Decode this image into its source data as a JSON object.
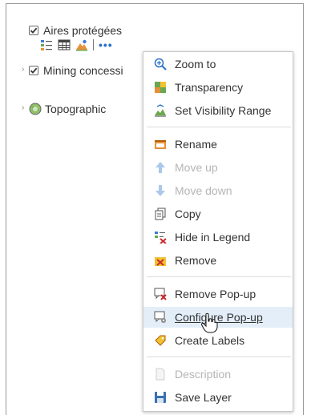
{
  "layers": [
    {
      "label": "Aires protégées",
      "checked": true
    },
    {
      "label": "Mining concessi",
      "checked": true
    },
    {
      "label": "Topographic",
      "checked": false
    }
  ],
  "toolbar": {
    "icons": [
      "legend-icon",
      "table-icon",
      "styles-icon"
    ],
    "more_label": "•••"
  },
  "menu": {
    "items": [
      {
        "label": "Zoom to",
        "icon": "zoom-in-icon",
        "enabled": true
      },
      {
        "label": "Transparency",
        "icon": "transparency-icon",
        "enabled": true
      },
      {
        "label": "Set Visibility Range",
        "icon": "visibility-range-icon",
        "enabled": true
      },
      {
        "label": "Rename",
        "icon": "rename-icon",
        "enabled": true
      },
      {
        "label": "Move up",
        "icon": "arrow-up-icon",
        "enabled": false
      },
      {
        "label": "Move down",
        "icon": "arrow-down-icon",
        "enabled": false
      },
      {
        "label": "Copy",
        "icon": "copy-icon",
        "enabled": true
      },
      {
        "label": "Hide in Legend",
        "icon": "hide-legend-icon",
        "enabled": true
      },
      {
        "label": "Remove",
        "icon": "remove-icon",
        "enabled": true
      },
      {
        "label": "Remove Pop-up",
        "icon": "remove-popup-icon",
        "enabled": true
      },
      {
        "label": "Configure Pop-up",
        "icon": "configure-popup-icon",
        "enabled": true,
        "hovered": true
      },
      {
        "label": "Create Labels",
        "icon": "create-labels-icon",
        "enabled": true
      },
      {
        "label": "Description",
        "icon": "description-icon",
        "enabled": false
      },
      {
        "label": "Save Layer",
        "icon": "save-icon",
        "enabled": true
      }
    ]
  },
  "colors": {
    "accent": "#2a72c8",
    "hover_bg": "#e3eef9",
    "disabled": "#b5b5b5"
  }
}
